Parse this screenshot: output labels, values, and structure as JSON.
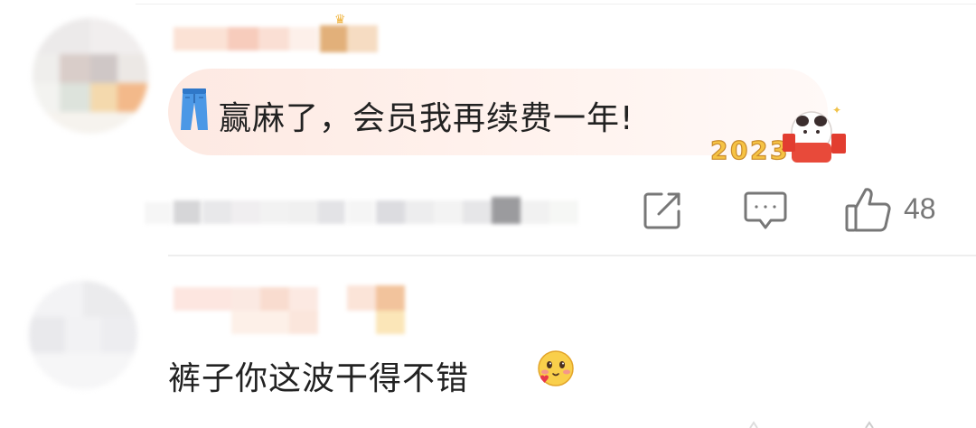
{
  "comments": [
    {
      "text": "赢麻了，会员我再续费一年!",
      "leading_icon": "jeans-emoji",
      "trailing_sticker": "2023-panda-sticker",
      "actions": {
        "share_icon": "share-icon",
        "reply_icon": "comment-icon",
        "like_icon": "thumbs-up-icon"
      },
      "like_count": "48"
    },
    {
      "text": "裤子你这波干得不错",
      "trailing_emoji": "blushing-face-emoji"
    }
  ],
  "colors": {
    "bubble": "#fde9e2",
    "text": "#222222",
    "icon": "#777777",
    "vip_gold": "#f0b23a"
  }
}
